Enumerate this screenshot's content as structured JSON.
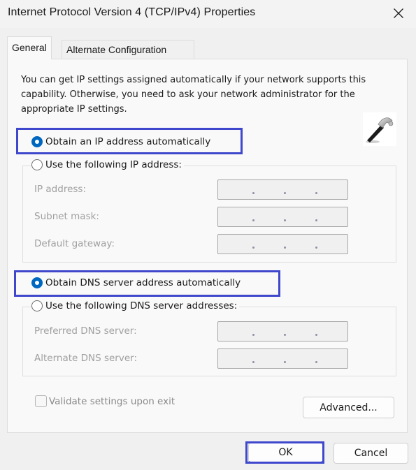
{
  "window": {
    "title": "Internet Protocol Version 4 (TCP/IPv4) Properties",
    "close_icon": "close-icon"
  },
  "tabs": [
    {
      "label": "General",
      "active": true
    },
    {
      "label": "Alternate Configuration",
      "active": false
    }
  ],
  "general": {
    "description": "You can get IP settings assigned automatically if your network supports this capability. Otherwise, you need to ask your network administrator for the appropriate IP settings.",
    "ip_auto_label": "Obtain an IP address automatically",
    "ip_manual_label": "Use the following IP address:",
    "ip_mode": "automatic",
    "ip_fields": [
      {
        "label": "IP address:",
        "value": ". . ."
      },
      {
        "label": "Subnet mask:",
        "value": ". . ."
      },
      {
        "label": "Default gateway:",
        "value": ". . ."
      }
    ],
    "dns_auto_label": "Obtain DNS server address automatically",
    "dns_manual_label": "Use the following DNS server addresses:",
    "dns_mode": "automatic",
    "dns_fields": [
      {
        "label": "Preferred DNS server:",
        "value": ". . ."
      },
      {
        "label": "Alternate DNS server:",
        "value": ". . ."
      }
    ],
    "validate_label": "Validate settings upon exit",
    "validate_checked": false,
    "advanced_label": "Advanced...",
    "decoration_icon": "hammer-icon"
  },
  "footer": {
    "ok_label": "OK",
    "cancel_label": "Cancel"
  },
  "annotations": {
    "highlight_color": "#3f48cc"
  }
}
